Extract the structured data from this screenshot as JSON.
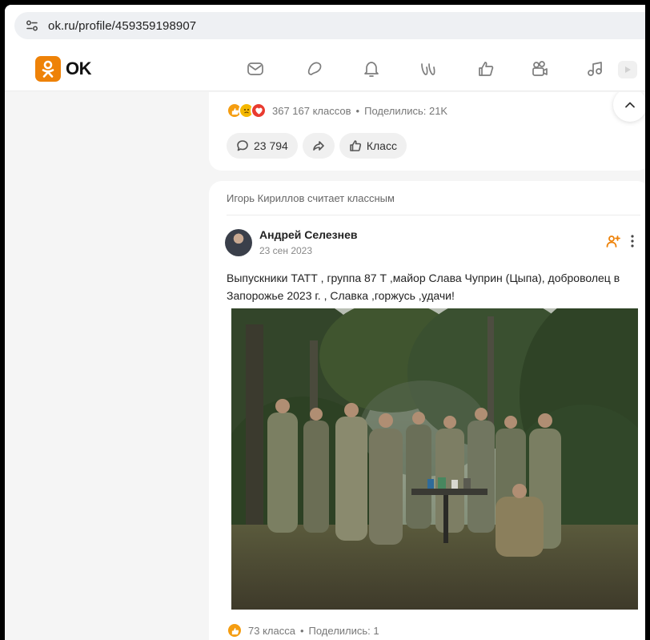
{
  "browser": {
    "url": "ok.ru/profile/459359198907"
  },
  "header": {
    "logo_text": "OK",
    "brand_color": "#ee8208",
    "nav_icons": [
      "messages-icon",
      "discussions-icon",
      "notifications-icon",
      "guests-icon",
      "events-icon",
      "friends-icon",
      "music-icon",
      "video-icon"
    ]
  },
  "prev_post": {
    "reactions_text": "367 167 классов",
    "separator": "•",
    "shares_text": "Поделились: 21K",
    "comments_count": "23 794",
    "like_label": "Класс"
  },
  "post": {
    "context": "Игорь Кириллов считает классным",
    "author": "Андрей Селезнев",
    "date": "23 сен 2023",
    "text": "Выпускники ТАТТ , группа 87 Т ,майор Слава Чуприн (Цыпа), доброволец в Запорожье 2023 г. , Славка ,горжусь ,удачи!",
    "reactions_text": "73 класса",
    "separator": "•",
    "shares_text": "Поделились: 1"
  }
}
